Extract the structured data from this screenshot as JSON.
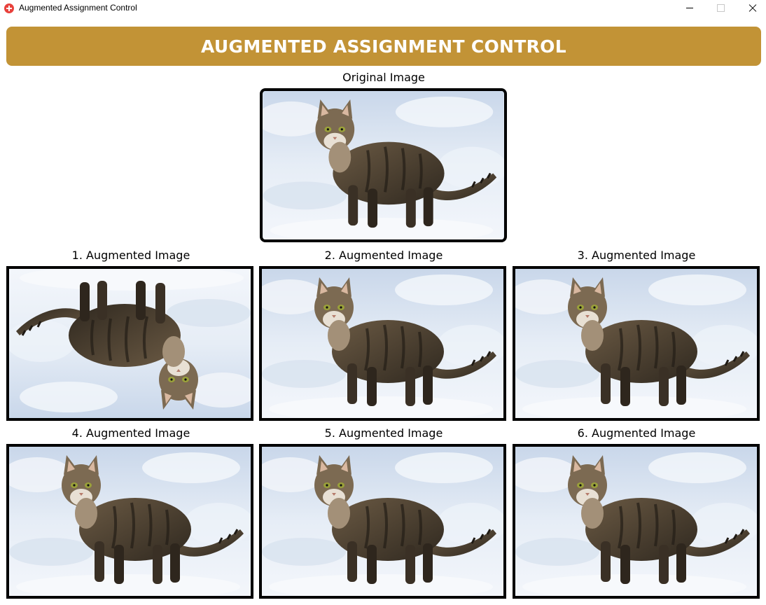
{
  "window": {
    "title": "Augmented Assignment Control",
    "icon": "app-icon",
    "controls": [
      "minimize-icon",
      "maximize-icon",
      "close-icon"
    ]
  },
  "header": {
    "title": "AUGMENTED ASSIGNMENT CONTROL",
    "background": "#c29336",
    "text_color": "#ffffff"
  },
  "original": {
    "label": "Original Image",
    "subject": "cat-on-snow-image"
  },
  "augmented": [
    {
      "label": "1. Augmented Image",
      "transform": "flipped"
    },
    {
      "label": "2. Augmented Image",
      "transform": "none"
    },
    {
      "label": "3. Augmented Image",
      "transform": "none"
    },
    {
      "label": "4. Augmented Image",
      "transform": "none"
    },
    {
      "label": "5. Augmented Image",
      "transform": "none"
    },
    {
      "label": "6. Augmented Image",
      "transform": "none"
    }
  ]
}
